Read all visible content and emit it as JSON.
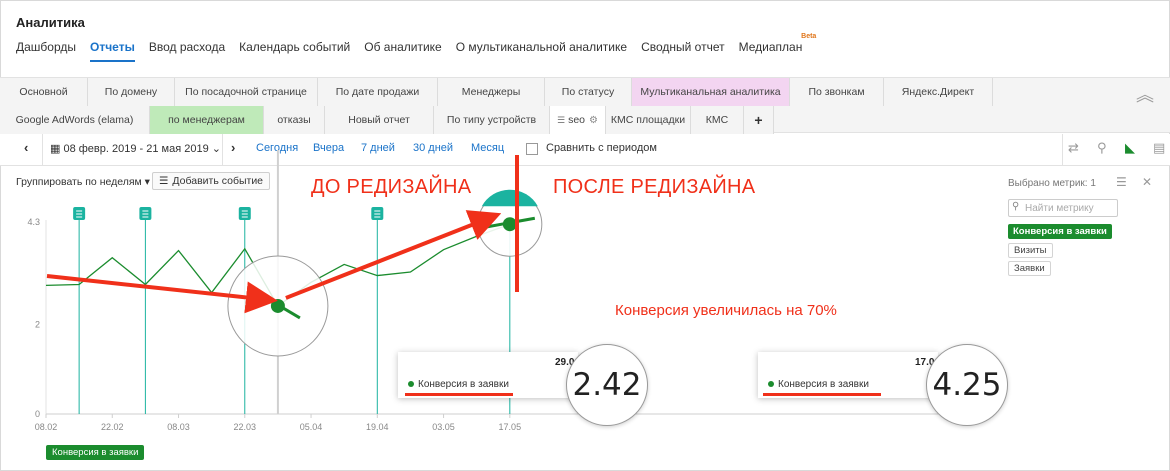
{
  "header": {
    "title": "Аналитика",
    "nav": [
      {
        "label": "Дашборды",
        "active": false
      },
      {
        "label": "Отчеты",
        "active": true
      },
      {
        "label": "Ввод расхода",
        "active": false
      },
      {
        "label": "Календарь событий",
        "active": false
      },
      {
        "label": "Об аналитике",
        "active": false
      },
      {
        "label": "О мультиканальной аналитике",
        "active": false
      },
      {
        "label": "Сводный отчет",
        "active": false
      },
      {
        "label": "Медиаплан",
        "active": false,
        "badge": "Beta"
      }
    ]
  },
  "tabs": {
    "row1": [
      {
        "label": "Основной"
      },
      {
        "label": "По домену"
      },
      {
        "label": "По посадочной странице"
      },
      {
        "label": "По дате продажи"
      },
      {
        "label": "Менеджеры"
      },
      {
        "label": "По статусу"
      },
      {
        "label": "Мультиканальная аналитика",
        "highlight": "pink"
      },
      {
        "label": "По звонкам"
      },
      {
        "label": "Яндекс.Директ"
      }
    ],
    "row2": [
      {
        "label": "Google AdWords (elama)"
      },
      {
        "label": "по менеджерам",
        "highlight": "green"
      },
      {
        "label": "отказы"
      },
      {
        "label": "Новый отчет"
      },
      {
        "label": "По типу устройств"
      },
      {
        "label": "seo",
        "active": true
      },
      {
        "label": "КМС площадки"
      },
      {
        "label": "КМС"
      },
      {
        "label": "+"
      }
    ]
  },
  "toolbar": {
    "date_range": "08 февр. 2019 - 21 мая 2019",
    "quick_links": [
      "Сегодня",
      "Вчера",
      "7 дней",
      "30 дней",
      "Месяц"
    ],
    "compare_label": "Сравнить с периодом"
  },
  "controls": {
    "group_by": "Группировать по неделям",
    "add_event": "Добавить событие",
    "metrics_count": "Выбрано метрик: 1",
    "search_placeholder": "Найти метрику",
    "metrics": [
      {
        "label": "Конверсия в заявки",
        "active": true
      },
      {
        "label": "Визиты",
        "active": false
      },
      {
        "label": "Заявки",
        "active": false
      }
    ],
    "legend": "Конверсия в заявки"
  },
  "chart_data": {
    "type": "line",
    "ylim": [
      0,
      4.3
    ],
    "y_ticks": [
      "0",
      "2",
      "4.3"
    ],
    "x_ticks": [
      "08.02",
      "22.02",
      "08.03",
      "22.03",
      "05.04",
      "19.04",
      "03.05",
      "17.05"
    ],
    "series": [
      {
        "name": "Конверсия в заявки",
        "color": "#1b8c2e",
        "x": [
          "08.02",
          "15.02",
          "22.02",
          "01.03",
          "08.03",
          "15.03",
          "22.03",
          "29.03",
          "05.04",
          "12.04",
          "19.04",
          "26.04",
          "03.05",
          "10.05",
          "17.05"
        ],
        "values": [
          2.88,
          2.9,
          3.5,
          2.9,
          3.66,
          2.72,
          3.7,
          2.42,
          2.95,
          3.35,
          3.1,
          3.18,
          3.68,
          3.98,
          4.25
        ]
      }
    ],
    "event_markers": [
      "15.02",
      "01.03",
      "22.03",
      "19.04"
    ]
  },
  "tooltips": [
    {
      "date": "29.0",
      "label": "Конверсия в заявки",
      "value": "2.42"
    },
    {
      "date": "17.0",
      "label": "Конверсия в заявки",
      "value": "4.25"
    }
  ],
  "annotations": {
    "before": "ДО РЕДИЗАЙНА",
    "after": "ПОСЛЕ РЕДИЗАЙНА",
    "result": "Конверсия увеличилась на 70%",
    "color": "#f0301a"
  },
  "colors": {
    "accent": "#1a73c9",
    "series_green": "#1b8c2e",
    "event_teal": "#1bb3a0",
    "annotation_red": "#f0301a"
  }
}
